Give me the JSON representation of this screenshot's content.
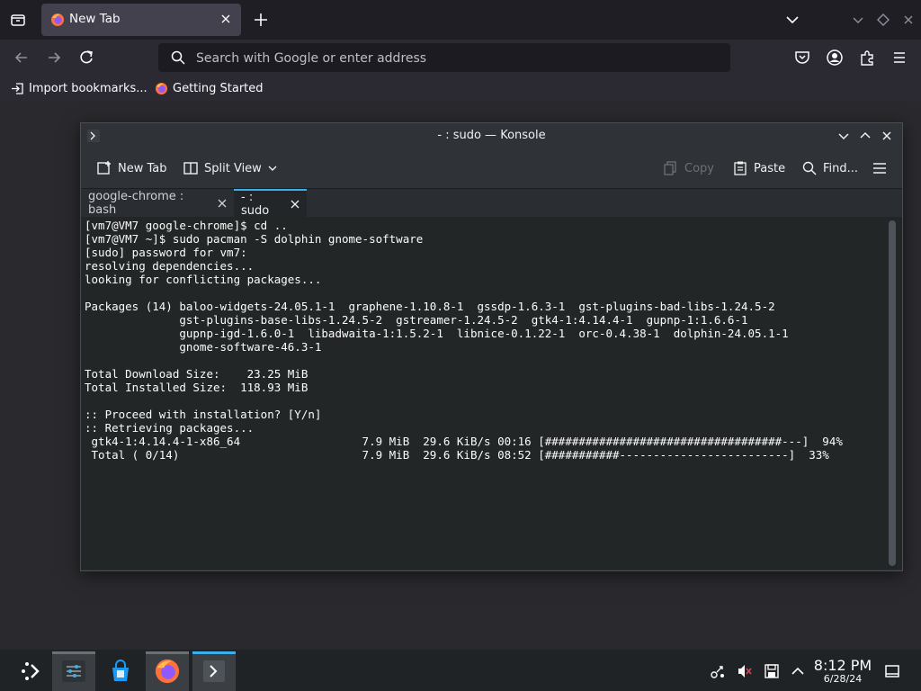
{
  "browser": {
    "tab": {
      "title": "New Tab"
    },
    "urlbar": {
      "placeholder": "Search with Google or enter address"
    },
    "bookmarks": [
      {
        "label": "Import bookmarks..."
      },
      {
        "label": "Getting Started"
      }
    ]
  },
  "konsole": {
    "title": "- : sudo — Konsole",
    "toolbar": {
      "new_tab": "New Tab",
      "split_view": "Split View",
      "copy": "Copy",
      "paste": "Paste",
      "find": "Find..."
    },
    "tabs": [
      {
        "label": "google-chrome : bash",
        "active": false
      },
      {
        "label": "- : sudo",
        "active": true
      }
    ],
    "terminal_lines": [
      "[vm7@VM7 google-chrome]$ cd ..",
      "[vm7@VM7 ~]$ sudo pacman -S dolphin gnome-software",
      "[sudo] password for vm7:",
      "resolving dependencies...",
      "looking for conflicting packages...",
      "",
      "Packages (14) baloo-widgets-24.05.1-1  graphene-1.10.8-1  gssdp-1.6.3-1  gst-plugins-bad-libs-1.24.5-2",
      "              gst-plugins-base-libs-1.24.5-2  gstreamer-1.24.5-2  gtk4-1:4.14.4-1  gupnp-1:1.6.6-1",
      "              gupnp-igd-1.6.0-1  libadwaita-1:1.5.2-1  libnice-0.1.22-1  orc-0.4.38-1  dolphin-24.05.1-1",
      "              gnome-software-46.3-1",
      "",
      "Total Download Size:    23.25 MiB",
      "Total Installed Size:  118.93 MiB",
      "",
      ":: Proceed with installation? [Y/n]",
      ":: Retrieving packages...",
      " gtk4-1:4.14.4-1-x86_64                  7.9 MiB  29.6 KiB/s 00:16 [###################################---]  94%",
      " Total ( 0/14)                           7.9 MiB  29.6 KiB/s 08:52 [###########-------------------------]  33%"
    ]
  },
  "taskbar": {
    "clock": {
      "time": "8:12 PM",
      "date": "6/28/24"
    }
  },
  "icons": {
    "browser": [
      "tab-list-icon",
      "firefox-icon",
      "close-icon",
      "plus-icon",
      "chevron-down-icon",
      "back-icon",
      "forward-icon",
      "reload-icon",
      "search-icon",
      "pocket-icon",
      "account-icon",
      "extensions-icon",
      "menu-icon",
      "import-icon"
    ],
    "konsole": [
      "terminal-icon",
      "new-tab-icon",
      "split-view-icon",
      "copy-icon",
      "paste-icon",
      "find-icon",
      "hamburger-icon"
    ],
    "taskbar": [
      "app-launcher-icon",
      "system-settings-icon",
      "discover-icon",
      "firefox-icon",
      "konsole-icon",
      "network-icon",
      "volume-muted-icon",
      "save-icon",
      "chevron-up-icon",
      "show-desktop-icon"
    ]
  },
  "colors": {
    "accent": "#3daee9",
    "firefox_tab": "#42414d",
    "terminal_bg": "#232627"
  }
}
